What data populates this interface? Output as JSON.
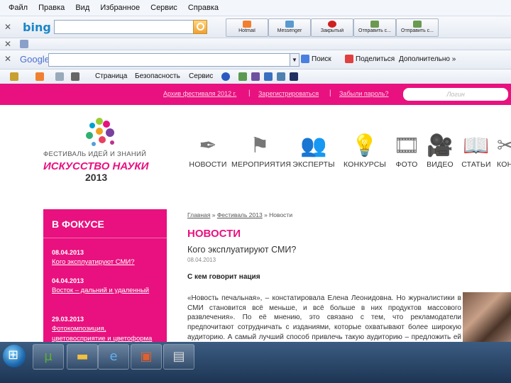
{
  "menubar": [
    "Файл",
    "Правка",
    "Вид",
    "Избранное",
    "Сервис",
    "Справка"
  ],
  "bing_bar": {
    "logo": "bing",
    "buttons": [
      "Hotmail",
      "Messenger",
      "Закрытый",
      "Отправить с...",
      "Отправить с..."
    ]
  },
  "google_bar": {
    "logo": "Google",
    "search_label": "Поиск",
    "share_label": "Поделиться",
    "more_label": "Дополнительно »"
  },
  "command_bar": {
    "page_label": "Страница",
    "security_label": "Безопасность",
    "tools_label": "Сервис"
  },
  "site": {
    "top_links": [
      "Архив фестиваля 2012 г.",
      "Зарегистрироваться",
      "Забыли пароль?"
    ],
    "login_placeholder": "Логин",
    "festival_line1": "ФЕСТИВАЛЬ ИДЕЙ И ЗНАНИЙ",
    "festival_line2": "ИСКУССТВО НАУКИ",
    "festival_year": "2013",
    "nav": [
      "НОВОСТИ",
      "МЕРОПРИЯТИЯ",
      "ЭКСПЕРТЫ",
      "КОНКУРСЫ",
      "ФОТО",
      "ВИДЕО",
      "СТАТЬИ",
      "КОН"
    ],
    "focus": {
      "title": "В ФОКУСЕ",
      "items": [
        {
          "date": "08.04.2013",
          "text": "Кого эксплуатируют СМИ?"
        },
        {
          "date": "04.04.2013",
          "text": "Восток – дальний и удаленный"
        },
        {
          "date": "29.03.2013",
          "text": "Фотокомпозиция, цветовосприятие и цветоформа"
        }
      ]
    },
    "breadcrumbs": {
      "home": "Главная",
      "festival": "Фестиваль 2013",
      "current": "Новости"
    },
    "news_heading": "НОВОСТИ",
    "article_title": "Кого эксплуатируют СМИ?",
    "article_date": "08.04.2013",
    "subheading": "С кем говорит нация",
    "body": "«Новость печальная», – констатировала Елена Леонидовна. Но журналистики в СМИ становится всё меньше, и всё больше в них продуктов массового развлечения». По её мнению, это связано с тем, что рекламодатели предпочитают сотрудничать с изданиями, которые охватывают более широкую аудиторию. А самый лучший способ привлечь такую аудиторию – предложить ей больше развлечений. В результате медиабизнес интегрирует в себя всё, в том числе и СМИ, в которых работают журналисты."
  },
  "colors": {
    "accent": "#e8117f",
    "taskbar": "#1d3553"
  }
}
